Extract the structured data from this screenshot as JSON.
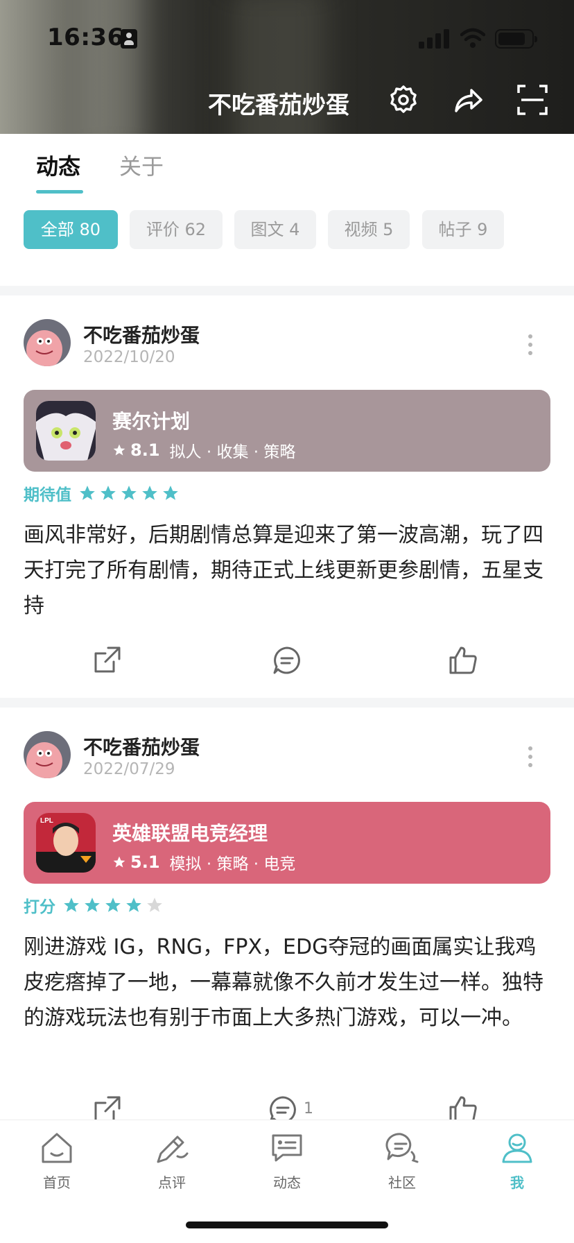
{
  "status_bar": {
    "time": "16:36"
  },
  "header": {
    "title": "不吃番茄炒蛋"
  },
  "tabs": [
    {
      "label": "动态",
      "active": true
    },
    {
      "label": "关于",
      "active": false
    }
  ],
  "filters": [
    {
      "label": "全部 80",
      "active": true
    },
    {
      "label": "评价 62"
    },
    {
      "label": "图文 4"
    },
    {
      "label": "视频 5"
    },
    {
      "label": "帖子 9"
    }
  ],
  "posts": [
    {
      "user": "不吃番茄炒蛋",
      "date": "2022/10/20",
      "game": {
        "title": "赛尔计划",
        "score": "8.1",
        "tags": "拟人 · 收集 · 策略",
        "card_color": "#a8969a"
      },
      "rating_label": "期待值",
      "rating_stars": 5,
      "content": "画风非常好，后期剧情总算是迎来了第一波高潮，玩了四天打完了所有剧情，期待正式上线更新更参剧情，五星支持",
      "comment_count": ""
    },
    {
      "user": "不吃番茄炒蛋",
      "date": "2022/07/29",
      "game": {
        "title": "英雄联盟电竞经理",
        "score": "5.1",
        "tags": "模拟 · 策略 · 电竞",
        "card_color": "#d9667a"
      },
      "rating_label": "打分",
      "rating_stars": 4,
      "content": "刚进游戏 IG，RNG，FPX，EDG夺冠的画面属实让我鸡皮疙瘩掉了一地，一幕幕就像不久前才发生过一样。独特的游戏玩法也有别于市面上大多热门游戏，可以一冲。",
      "comment_count": "1"
    }
  ],
  "bottom_nav": [
    {
      "label": "首页",
      "icon": "home-icon"
    },
    {
      "label": "点评",
      "icon": "review-pen-icon"
    },
    {
      "label": "动态",
      "icon": "feed-icon"
    },
    {
      "label": "社区",
      "icon": "community-chat-icon"
    },
    {
      "label": "我",
      "icon": "profile-icon",
      "active": true
    }
  ],
  "colors": {
    "accent": "#4fbfc8",
    "star_inactive": "#d8d8d8"
  }
}
